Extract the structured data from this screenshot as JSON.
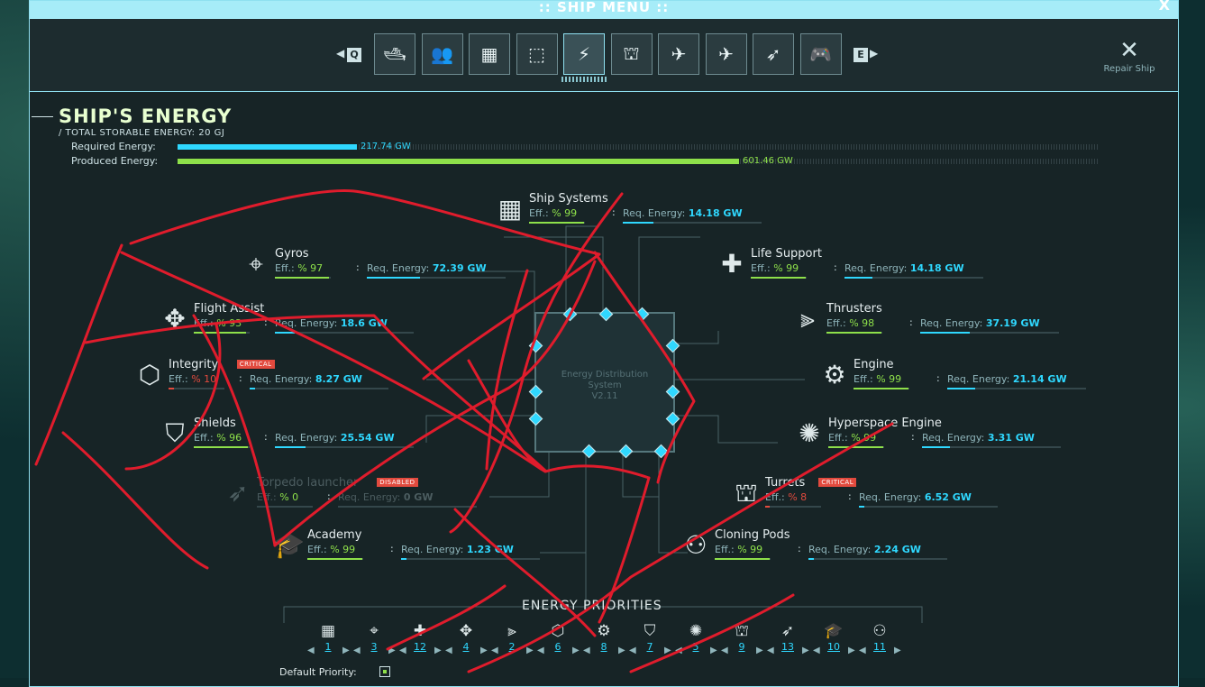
{
  "window": {
    "title": ":: SHIP MENU ::",
    "close": "X"
  },
  "toolbar": {
    "prev_key": "Q",
    "next_key": "E",
    "tabs": [
      {
        "icon": "ship-hull-icon",
        "glyph": "🛥",
        "active": false
      },
      {
        "icon": "crew-icon",
        "glyph": "👥",
        "active": false
      },
      {
        "icon": "ship-systems-icon",
        "glyph": "▦",
        "active": false
      },
      {
        "icon": "cargo-icon",
        "glyph": "⬚",
        "active": false
      },
      {
        "icon": "energy-icon",
        "glyph": "⚡",
        "active": true
      },
      {
        "icon": "turret-icon",
        "glyph": "⛫",
        "active": false
      },
      {
        "icon": "hangar-icon",
        "glyph": "✈",
        "active": false
      },
      {
        "icon": "fighter-icon",
        "glyph": "✈",
        "active": false
      },
      {
        "icon": "torpedo-icon",
        "glyph": "➶",
        "active": false
      },
      {
        "icon": "gamepad-icon",
        "glyph": "🎮",
        "active": false
      }
    ],
    "repair_label": "Repair Ship",
    "repair_icon": "wrench-screwdriver-icon"
  },
  "energy": {
    "title": "SHIP'S ENERGY",
    "total": "/  TOTAL STORABLE ENERGY: 20 GJ",
    "required_label": "Required Energy:",
    "required_value": "217.74 GW",
    "required_fraction": 0.195,
    "produced_label": "Produced Energy:",
    "produced_value": "601.46 GW",
    "produced_fraction": 0.61
  },
  "core": {
    "line1": "Energy Distribution",
    "line2": "System",
    "line3": "V2.11"
  },
  "systems": [
    {
      "name": "Ship Systems",
      "icon": "ship-systems-icon",
      "glyph": "▦",
      "eff": "% 99",
      "eff_frac": 0.99,
      "req": "14.18 GW",
      "req_frac": 0.22,
      "badge": ""
    },
    {
      "name": "Gyros",
      "icon": "gyro-icon",
      "glyph": "⌖",
      "eff": "% 97",
      "eff_frac": 0.97,
      "req": "72.39 GW",
      "req_frac": 0.38,
      "badge": ""
    },
    {
      "name": "Life Support",
      "icon": "medical-cross-icon",
      "glyph": "✚",
      "eff": "% 99",
      "eff_frac": 0.99,
      "req": "14.18 GW",
      "req_frac": 0.2,
      "badge": ""
    },
    {
      "name": "Flight Assist",
      "icon": "move-arrows-icon",
      "glyph": "✥",
      "eff": "% 93",
      "eff_frac": 0.93,
      "req": "18.6 GW",
      "req_frac": 0.14,
      "badge": ""
    },
    {
      "name": "Thrusters",
      "icon": "thrusters-icon",
      "glyph": "⫸",
      "eff": "% 98",
      "eff_frac": 0.98,
      "req": "37.19 GW",
      "req_frac": 0.36,
      "badge": ""
    },
    {
      "name": "Integrity",
      "icon": "cube-icon",
      "glyph": "⬡",
      "eff": "% 10",
      "eff_frac": 0.1,
      "req": "8.27 GW",
      "req_frac": 0.04,
      "badge": "CRITICAL",
      "eff_color": "#e24a3e"
    },
    {
      "name": "Engine",
      "icon": "engine-icon",
      "glyph": "⚙",
      "eff": "% 99",
      "eff_frac": 0.99,
      "req": "21.14 GW",
      "req_frac": 0.2,
      "badge": ""
    },
    {
      "name": "Shields",
      "icon": "shield-icon",
      "glyph": "⛉",
      "eff": "% 96",
      "eff_frac": 0.96,
      "req": "25.54 GW",
      "req_frac": 0.22,
      "badge": ""
    },
    {
      "name": "Hyperspace Engine",
      "icon": "hyperspace-icon",
      "glyph": "✺",
      "eff": "% 99",
      "eff_frac": 0.99,
      "req": "3.31 GW",
      "req_frac": 0.2,
      "badge": ""
    },
    {
      "name": "Torpedo launcher",
      "icon": "torpedo-icon",
      "glyph": "➶",
      "eff": "% 0",
      "eff_frac": 0,
      "req": "0 GW",
      "req_frac": 0,
      "badge": "DISABLED",
      "disabled": true
    },
    {
      "name": "Turrets",
      "icon": "turret-icon",
      "glyph": "⛫",
      "eff": "% 8",
      "eff_frac": 0.08,
      "req": "6.52 GW",
      "req_frac": 0.04,
      "badge": "CRITICAL",
      "eff_color": "#e24a3e"
    },
    {
      "name": "Academy",
      "icon": "academy-icon",
      "glyph": "🎓",
      "eff": "% 99",
      "eff_frac": 0.99,
      "req": "1.23 GW",
      "req_frac": 0.04,
      "badge": ""
    },
    {
      "name": "Cloning Pods",
      "icon": "cloning-icon",
      "glyph": "⚇",
      "eff": "% 99",
      "eff_frac": 0.99,
      "req": "2.24 GW",
      "req_frac": 0.04,
      "badge": ""
    }
  ],
  "labels": {
    "eff": "Eff.:",
    "req": "Req. Energy:"
  },
  "priorities": {
    "title": "ENERGY PRIORITIES",
    "items": [
      {
        "icon": "ship-systems-icon",
        "glyph": "▦",
        "num": "1"
      },
      {
        "icon": "gyro-icon",
        "glyph": "⌖",
        "num": "3"
      },
      {
        "icon": "medical-cross-icon",
        "glyph": "✚",
        "num": "12"
      },
      {
        "icon": "move-arrows-icon",
        "glyph": "✥",
        "num": "4"
      },
      {
        "icon": "thrusters-icon",
        "glyph": "⫸",
        "num": "2"
      },
      {
        "icon": "cube-icon",
        "glyph": "⬡",
        "num": "6"
      },
      {
        "icon": "engine-icon",
        "glyph": "⚙",
        "num": "8"
      },
      {
        "icon": "shield-icon",
        "glyph": "⛉",
        "num": "7"
      },
      {
        "icon": "hyperspace-icon",
        "glyph": "✺",
        "num": "5"
      },
      {
        "icon": "turret-icon",
        "glyph": "⛫",
        "num": "9"
      },
      {
        "icon": "torpedo-icon",
        "glyph": "➶",
        "num": "13"
      },
      {
        "icon": "academy-icon",
        "glyph": "🎓",
        "num": "10"
      },
      {
        "icon": "cloning-icon",
        "glyph": "⚇",
        "num": "11"
      }
    ],
    "default_label": "Default Priority:"
  }
}
